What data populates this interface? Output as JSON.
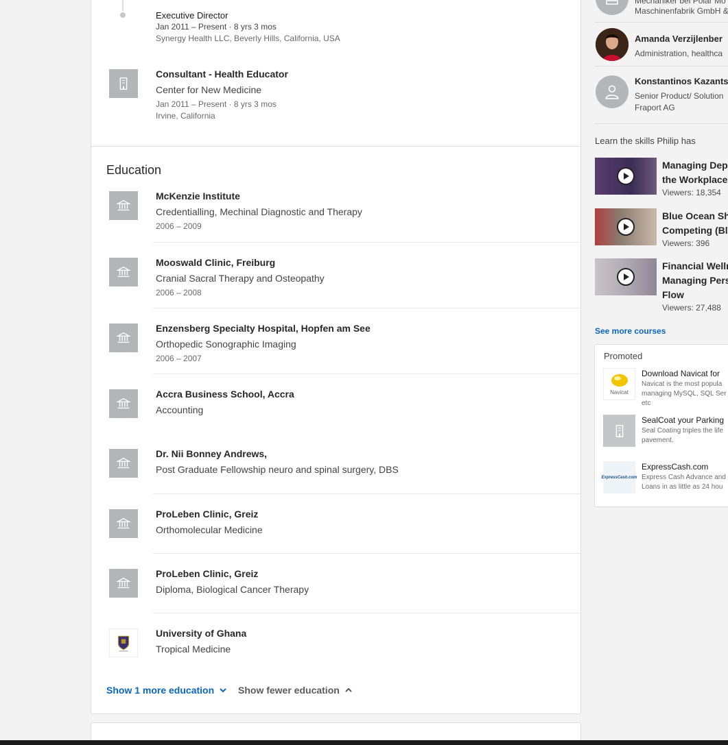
{
  "experience": {
    "partial_role": {
      "title": "Executive Director",
      "dates": "Jan 2011 – Present · 8 yrs 3 mos",
      "location": "Synergy Health LLC, Beverly Hills, California, USA"
    },
    "role": {
      "title": "Consultant - Health Educator",
      "company": "Center for New Medicine",
      "dates": "Jan 2011 – Present · 8 yrs 3 mos",
      "location": "Irvine, California"
    }
  },
  "education": {
    "heading": "Education",
    "items": [
      {
        "school": "McKenzie Institute",
        "degree": "Credentialling, Mechinal Diagnostic and Therapy",
        "dates": "2006 – 2009"
      },
      {
        "school": "Mooswald Clinic, Freiburg",
        "degree": "Cranial Sacral Therapy and Osteopathy",
        "dates": "2006 – 2008"
      },
      {
        "school": "Enzensberg Specialty Hospital, Hopfen am See",
        "degree": "Orthopedic Sonographic Imaging",
        "dates": "2006 – 2007"
      },
      {
        "school": "Accra Business School, Accra",
        "degree": "Accounting",
        "dates": ""
      },
      {
        "school": "Dr. Nii Bonney Andrews,",
        "degree": "Post Graduate Fellowship neuro and spinal surgery, DBS",
        "dates": ""
      },
      {
        "school": "ProLeben Clinic, Greiz",
        "degree": "Orthomolecular Medicine",
        "dates": ""
      },
      {
        "school": "ProLeben Clinic, Greiz",
        "degree": "Diploma, Biological Cancer Therapy",
        "dates": ""
      },
      {
        "school": "University of Ghana",
        "degree": "Tropical Medicine",
        "dates": ""
      }
    ],
    "show_more": "Show 1 more education",
    "show_fewer": "Show fewer education"
  },
  "rail": {
    "people": [
      {
        "name": "",
        "desc_line1": "Mechaniker bei Polar Mo",
        "desc_line2": "Maschinenfabrik GmbH &"
      },
      {
        "name": "Amanda Verzijlenber",
        "desc_line1": "Administration, healthca",
        "desc_line2": ""
      },
      {
        "name": "Konstantinos Kazants",
        "desc_line1": "Senior Product/ Solution",
        "desc_line2": "Fraport AG"
      }
    ],
    "courses_heading": "Learn the skills Philip has",
    "courses": [
      {
        "title_line1": "Managing Dep",
        "title_line2": "the Workplace",
        "title_line3": "",
        "viewers": "Viewers: 18,354"
      },
      {
        "title_line1": "Blue Ocean Shi",
        "title_line2": "Competing (Bli",
        "title_line3": "",
        "viewers": "Viewers: 396"
      },
      {
        "title_line1": "Financial Welln",
        "title_line2": "Managing Pers",
        "title_line3": "Flow",
        "viewers": "Viewers: 27,488"
      }
    ],
    "see_more_courses": "See more courses",
    "promoted": {
      "label": "Promoted",
      "ads": [
        {
          "logo_text": "Navicat",
          "title": "Download Navicat for",
          "desc_line1": "Navicat is the most popula",
          "desc_line2": "managing MySQL, SQL Ser",
          "desc_line3": "etc"
        },
        {
          "logo_text": "",
          "title": "SealCoat your Parking",
          "desc_line1": "Seal Coating triples the life",
          "desc_line2": "pavement.",
          "desc_line3": ""
        },
        {
          "logo_text": "ExpressCash.com",
          "title": "ExpressCash.com",
          "desc_line1": "Express Cash Advance and",
          "desc_line2": "Loans in as little as 24 hou",
          "desc_line3": ""
        }
      ]
    }
  }
}
